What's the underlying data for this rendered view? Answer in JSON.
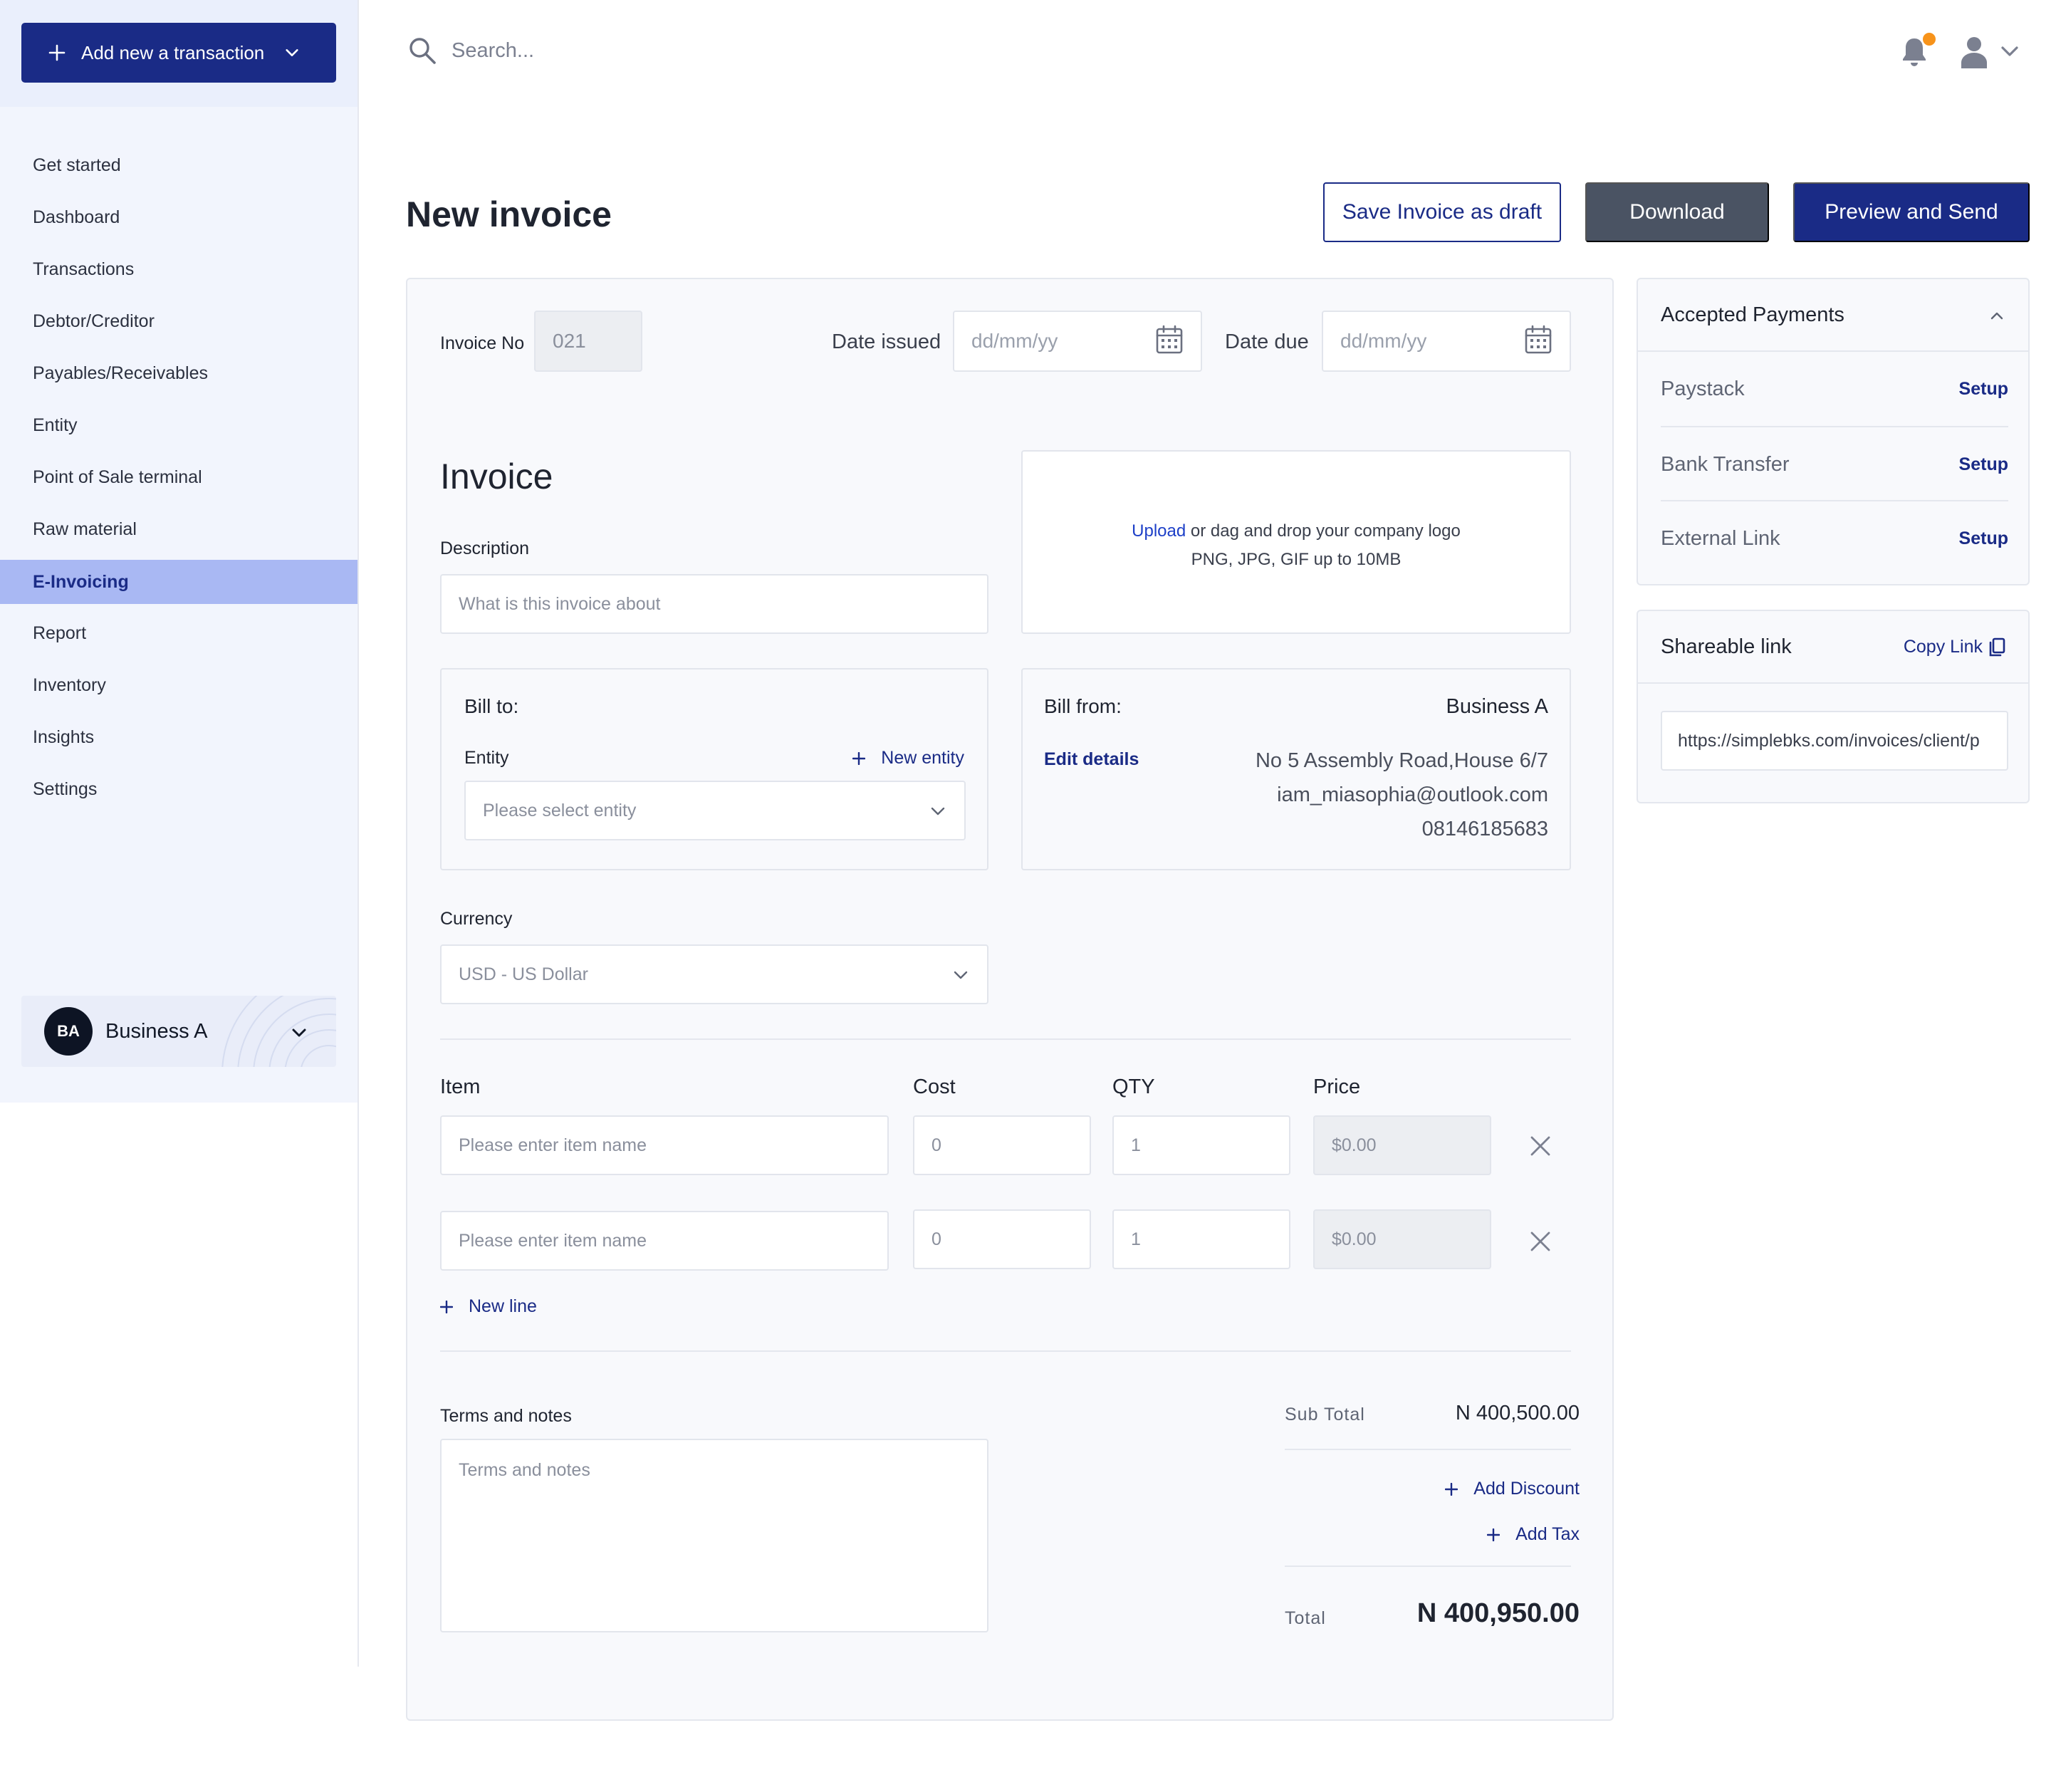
{
  "sidebar": {
    "add_button": "Add new a transaction",
    "nav": [
      "Get started",
      "Dashboard",
      "Transactions",
      "Debtor/Creditor",
      "Payables/Receivables",
      "Entity",
      "Point of Sale terminal",
      "Raw material",
      "E-Invoicing",
      "Report",
      "Inventory",
      "Insights",
      "Settings"
    ],
    "active_item": "E-Invoicing",
    "business": {
      "initials": "BA",
      "name": "Business A"
    }
  },
  "topbar": {
    "search_placeholder": "Search..."
  },
  "header": {
    "title": "New invoice",
    "save_draft": "Save Invoice as draft",
    "download": "Download",
    "preview_send": "Preview and Send"
  },
  "invoice": {
    "invoice_no_label": "Invoice No",
    "invoice_no": "021",
    "date_issued_label": "Date issued",
    "date_issued_placeholder": "dd/mm/yy",
    "date_due_label": "Date due",
    "date_due_placeholder": "dd/mm/yy",
    "heading": "Invoice",
    "description_label": "Description",
    "description_placeholder": "What is this invoice about",
    "upload": {
      "link": "Upload",
      "text": " or dag and drop your company logo",
      "hint": "PNG, JPG, GIF up to 10MB"
    },
    "bill_to": {
      "title": "Bill to:",
      "entity_label": "Entity",
      "new_entity": "New entity",
      "entity_placeholder": "Please select entity"
    },
    "bill_from": {
      "title": "Bill from:",
      "business": "Business A",
      "edit": "Edit details",
      "address": "No 5 Assembly Road,House 6/7",
      "email": "iam_miasophia@outlook.com",
      "phone": "08146185683"
    },
    "currency_label": "Currency",
    "currency_value": "USD - US Dollar",
    "items": {
      "headers": {
        "item": "Item",
        "cost": "Cost",
        "qty": "QTY",
        "price": "Price"
      },
      "rows": [
        {
          "item_placeholder": "Please enter item name",
          "cost": "0",
          "qty": "1",
          "price": "$0.00"
        },
        {
          "item_placeholder": "Please enter item name",
          "cost": "0",
          "qty": "1",
          "price": "$0.00"
        }
      ],
      "new_line": "New line"
    },
    "terms_label": "Terms and notes",
    "terms_placeholder": "Terms and notes",
    "totals": {
      "subtotal_label": "Sub Total",
      "subtotal": "N 400,500.00",
      "add_discount": "Add Discount",
      "add_tax": "Add Tax",
      "total_label": "Total",
      "total": "N 400,950.00"
    }
  },
  "payments": {
    "title": "Accepted Payments",
    "methods": [
      {
        "name": "Paystack",
        "action": "Setup"
      },
      {
        "name": "Bank Transfer",
        "action": "Setup"
      },
      {
        "name": "External Link",
        "action": "Setup"
      }
    ]
  },
  "share": {
    "title": "Shareable link",
    "copy": "Copy Link",
    "url": "https://simplebks.com/invoices/client/p"
  },
  "colors": {
    "primary": "#1a2b86",
    "active_nav": "#a9b8f3",
    "download": "#4a5363",
    "notification": "#f7931a"
  }
}
